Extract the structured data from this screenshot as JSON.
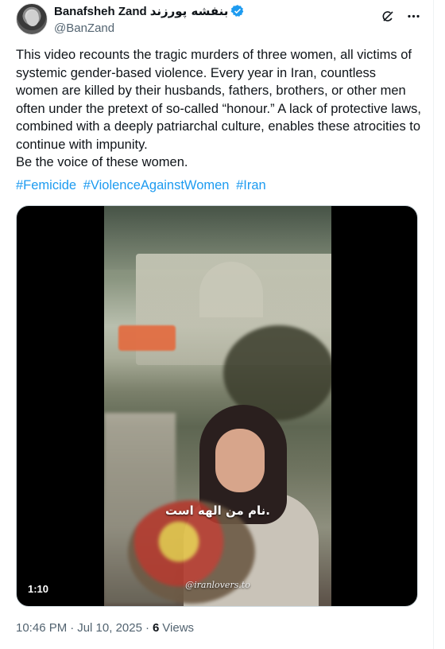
{
  "author": {
    "display_name": "Banafsheh Zand",
    "display_name_fa": "بنفشه پورزند",
    "handle": "@BanZand",
    "verified": true
  },
  "tweet": {
    "text": "This video recounts the tragic murders of three women, all victims of systemic gender-based violence. Every year in Iran, countless women are killed by their husbands, fathers, brothers, or other men often under the pretext of so-called “honour.” A lack of protective laws, combined with a deeply patriarchal culture, enables these atrocities to continue with impunity.\nBe the voice of these women.",
    "hashtags": [
      "#Femicide",
      "#ViolenceAgainstWomen",
      "#Iran"
    ]
  },
  "media": {
    "subtitle": "نام من الهه است.",
    "watermark": "@iranlovers.to",
    "duration": "1:10"
  },
  "meta": {
    "time": "10:46 PM",
    "date": "Jul 10, 2025",
    "views_count": "6",
    "views_label": "Views"
  },
  "icons": {
    "verified": "verified-badge-icon",
    "grok": "grok-icon",
    "more": "more-icon"
  },
  "colors": {
    "link": "#1d9bf0",
    "secondary_text": "#536471",
    "primary_text": "#0f1419"
  }
}
